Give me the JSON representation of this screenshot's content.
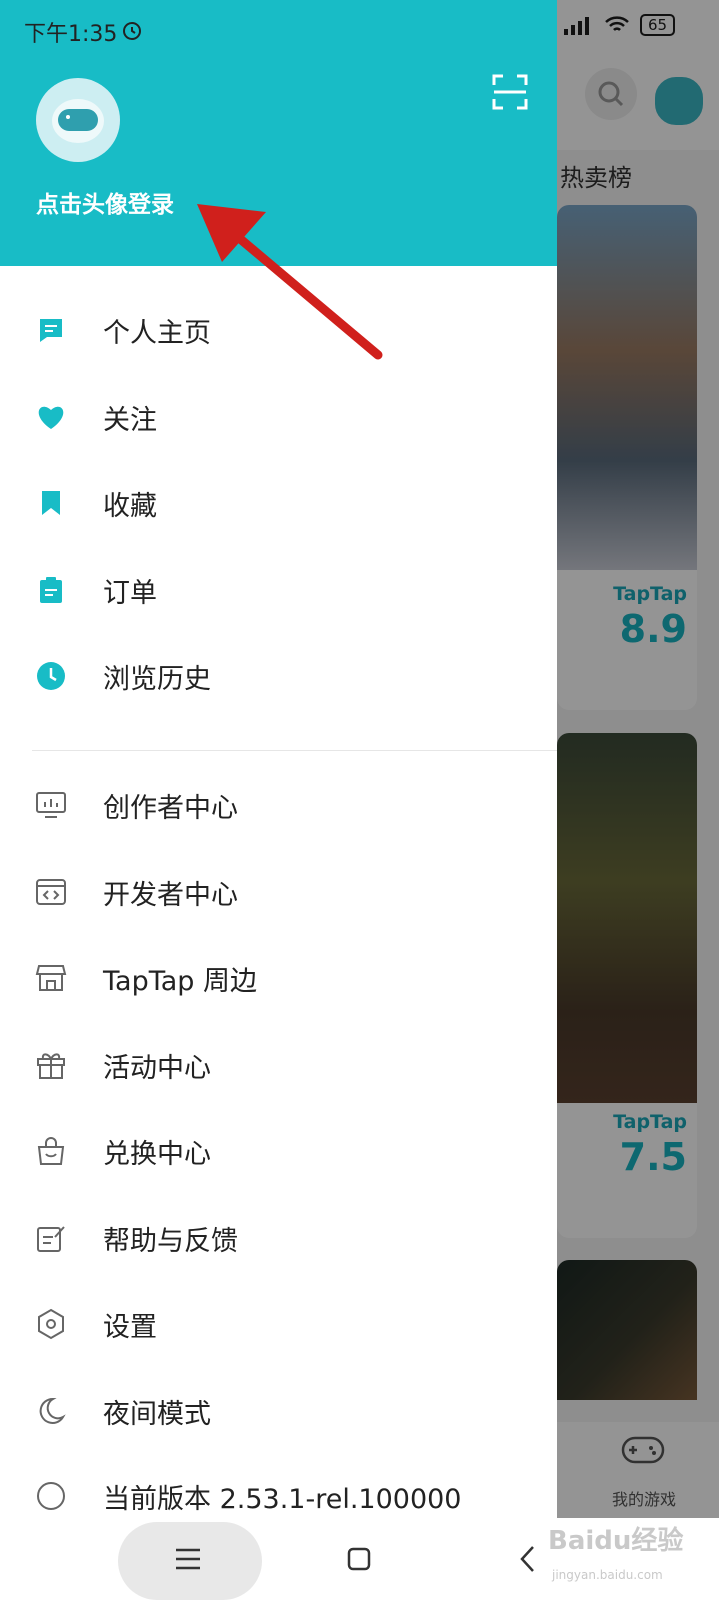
{
  "status": {
    "time": "下午1:35",
    "battery": "65"
  },
  "background": {
    "tab_label": "热卖榜",
    "cards": [
      {
        "brand": "TapTap",
        "score": "8.9"
      },
      {
        "brand": "TapTap",
        "score": "7.5"
      }
    ],
    "bottom_nav_label": "我的游戏"
  },
  "drawer": {
    "login_prompt": "点击头像登录",
    "primary_items": [
      {
        "label": "个人主页",
        "icon": "comment-icon"
      },
      {
        "label": "关注",
        "icon": "heart-icon"
      },
      {
        "label": "收藏",
        "icon": "bookmark-icon"
      },
      {
        "label": "订单",
        "icon": "clipboard-icon"
      },
      {
        "label": "浏览历史",
        "icon": "clock-icon"
      }
    ],
    "secondary_items": [
      {
        "label": "创作者中心",
        "icon": "monitor-chart-icon"
      },
      {
        "label": "开发者中心",
        "icon": "code-window-icon"
      },
      {
        "label": "TapTap 周边",
        "icon": "store-icon"
      },
      {
        "label": "活动中心",
        "icon": "gift-icon"
      },
      {
        "label": "兑换中心",
        "icon": "shopping-bag-icon"
      },
      {
        "label": "帮助与反馈",
        "icon": "edit-note-icon"
      },
      {
        "label": "设置",
        "icon": "hexagon-settings-icon"
      },
      {
        "label": "夜间模式",
        "icon": "moon-icon"
      },
      {
        "label": "当前版本 2.53.1-rel.100000",
        "icon": "info-icon"
      }
    ]
  },
  "colors": {
    "accent": "#18bcc6",
    "arrow": "#d0201c"
  },
  "watermark": {
    "text": "Baidu经验",
    "sub": "jingyan.baidu.com"
  }
}
